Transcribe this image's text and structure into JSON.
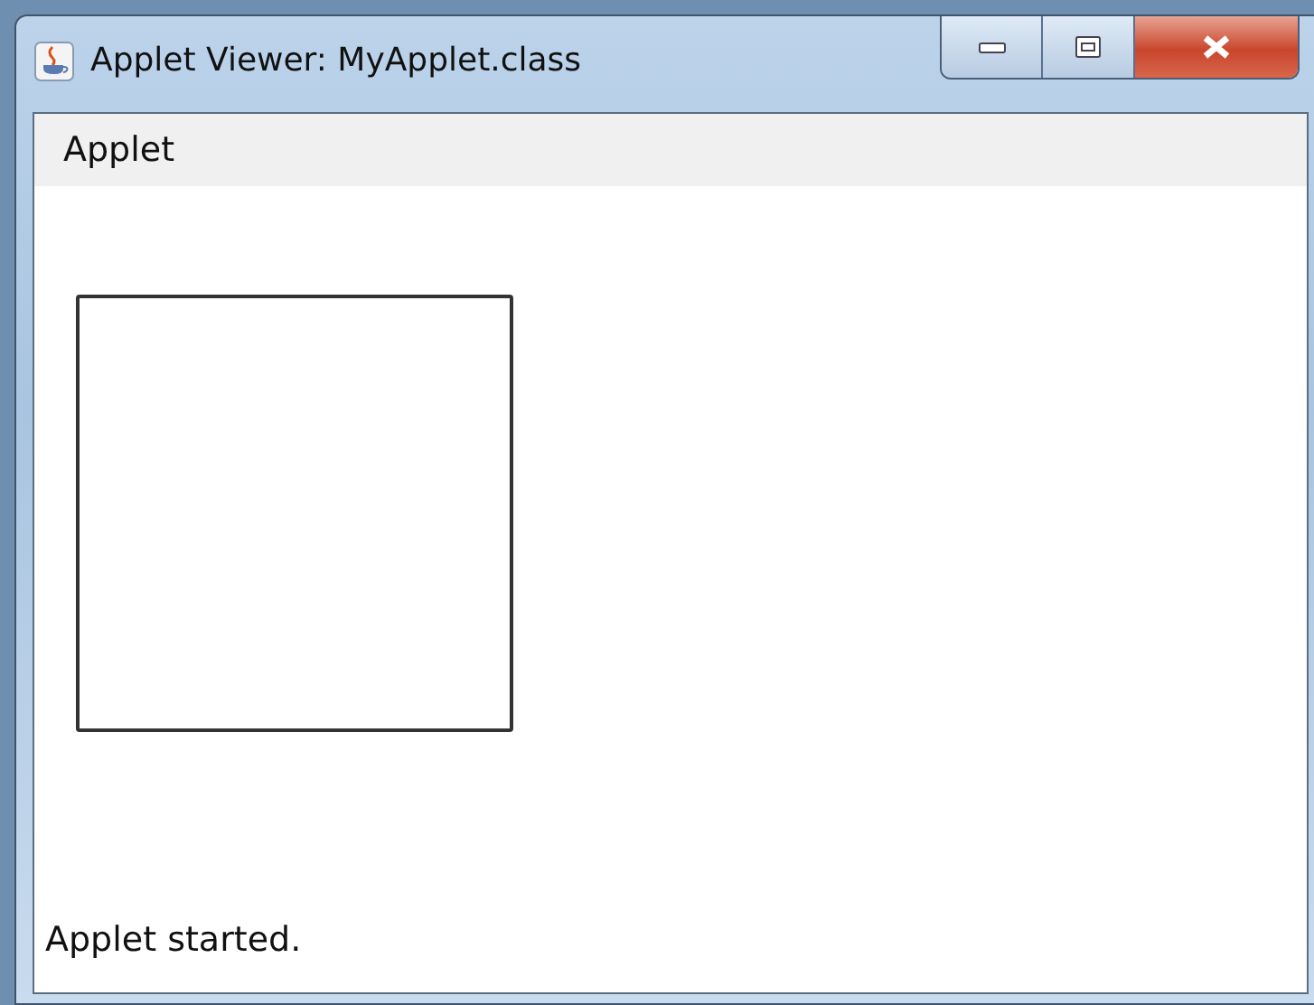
{
  "window": {
    "title": "Applet Viewer: MyApplet.class"
  },
  "menu_bar": {
    "items": [
      "Applet"
    ]
  },
  "status_bar": {
    "text": "Applet started."
  }
}
